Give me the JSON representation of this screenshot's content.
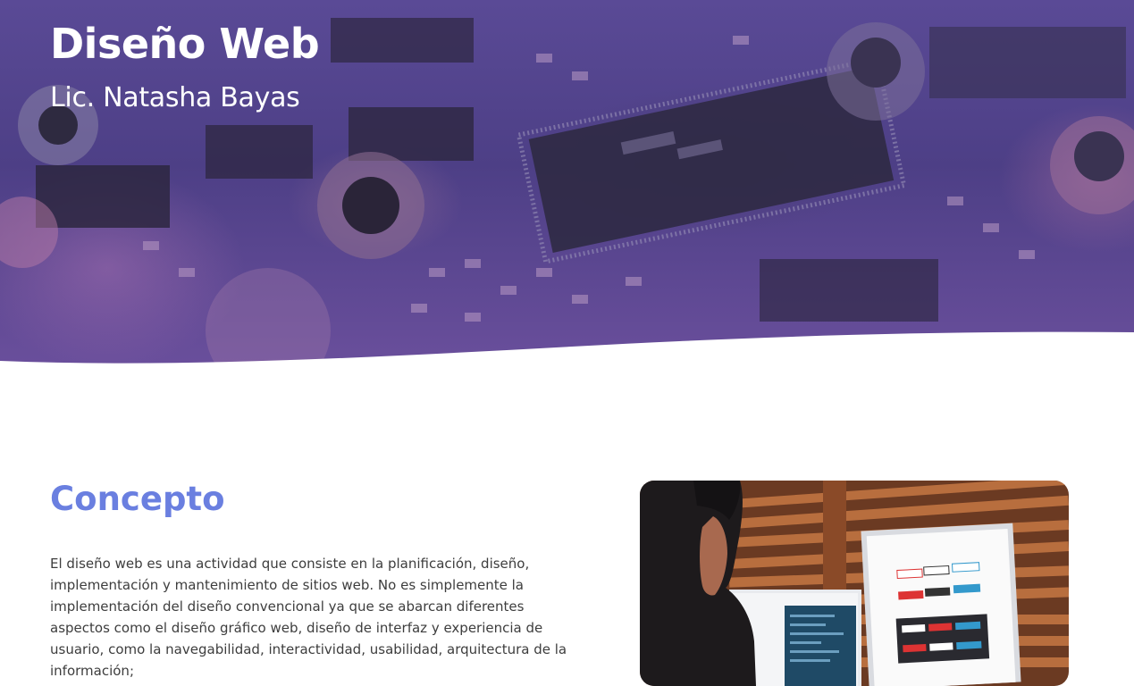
{
  "hero": {
    "title": "Diseño Web",
    "subtitle": "Lic. Natasha Bayas",
    "background_image": "circuit-board-photo",
    "overlay_color": "#5b4a9a"
  },
  "concept": {
    "title": "Concepto",
    "body": "El diseño web es una actividad que consiste en la planificación, diseño, implementación y mantenimiento de sitios web. No es simplemente la implementación del diseño convencional ya que se abarcan diferentes aspectos como el diseño gráfico web, diseño de interfaz y experiencia de usuario, como la navegabilidad, interactividad, usabilidad, arquitectura de la información;",
    "image": "designer-at-monitors-photo"
  },
  "colors": {
    "accent": "#6a7fe0",
    "text": "#3d3d3d",
    "hero_text": "#ffffff"
  }
}
